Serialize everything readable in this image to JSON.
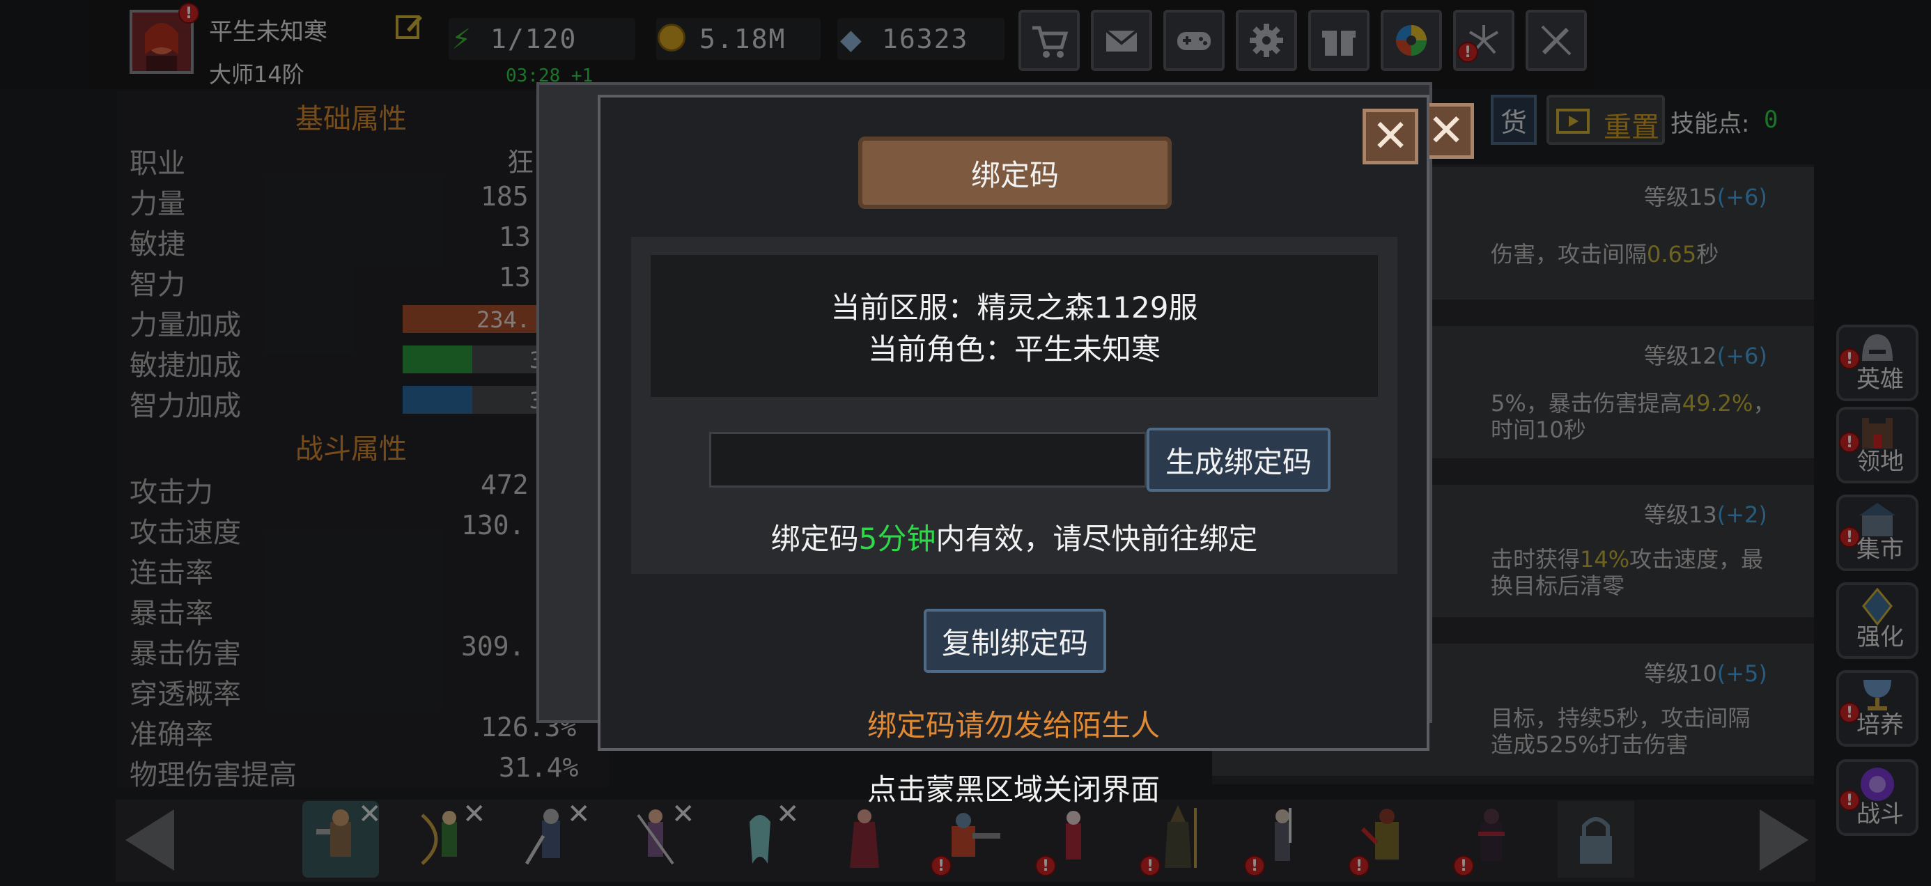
{
  "player": {
    "name": "平生未知寒",
    "rank": "大师14阶",
    "timer": "03:28 +1"
  },
  "resources": {
    "energy": "1/120",
    "gold": "5.18M",
    "gems": "16323"
  },
  "toolbar_icons": [
    "cart-icon",
    "mail-icon",
    "gamepad-icon",
    "gear-icon",
    "gift-icon",
    "color-wheel-icon",
    "fireworks-icon",
    "no-sword-icon"
  ],
  "stats": {
    "basic_title": "基础属性",
    "combat_title": "战斗属性",
    "basic": [
      {
        "name": "职业",
        "value": "狂"
      },
      {
        "name": "力量",
        "value": "185"
      },
      {
        "name": "敏捷",
        "value": "13"
      },
      {
        "name": "智力",
        "value": "13"
      }
    ],
    "bonuses": [
      {
        "name": "力量加成",
        "value": "234.",
        "color": "#a9512e",
        "fill": 1.0
      },
      {
        "name": "敏捷加成",
        "value": "3",
        "color": "#2a9a3c",
        "fill": 0.5
      },
      {
        "name": "智力加成",
        "value": "3",
        "color": "#2c6aa2",
        "fill": 0.5
      }
    ],
    "combat": [
      {
        "name": "攻击力",
        "value": "472"
      },
      {
        "name": "攻击速度",
        "value": "130."
      },
      {
        "name": "连击率",
        "value": ""
      },
      {
        "name": "暴击率",
        "value": ""
      },
      {
        "name": "暴击伤害",
        "value": "309."
      },
      {
        "name": "穿透概率",
        "value": ""
      },
      {
        "name": "准确率",
        "value": "126.3%"
      },
      {
        "name": "物理伤害提高",
        "value": "31.4%"
      }
    ]
  },
  "skills_header": {
    "reset_label": "重置",
    "partial_tab": "货",
    "points_label": "技能点:",
    "points_value": "0"
  },
  "skills": [
    {
      "level": "等级15",
      "bonus": "(+6)",
      "line1_a": "伤害，攻击间隔",
      "line1_hl": "0.65",
      "line1_b": "秒",
      "line2": ""
    },
    {
      "level": "等级12",
      "bonus": "(+6)",
      "line1_a": "5%，暴击伤害提高",
      "line1_hl": "49.2%",
      "line1_b": "，",
      "line2": "时间10秒"
    },
    {
      "level": "等级13",
      "bonus": "(+2)",
      "line1_a": "击时获得",
      "line1_hl": "14%",
      "line1_b": "攻击速度，最",
      "line2": "换目标后清零"
    },
    {
      "level": "等级10",
      "bonus": "(+5)",
      "line1_a": "目标，持续5秒，攻击间隔",
      "line1_hl": "",
      "line1_b": "",
      "line2": "造成525%打击伤害"
    }
  ],
  "side_nav": [
    {
      "label": "英雄",
      "icon": "helmet-icon"
    },
    {
      "label": "领地",
      "icon": "castle-icon"
    },
    {
      "label": "集市",
      "icon": "shop-icon"
    },
    {
      "label": "强化",
      "icon": "crystal-icon"
    },
    {
      "label": "培养",
      "icon": "chalice-icon"
    },
    {
      "label": "战斗",
      "icon": "portal-icon"
    }
  ],
  "dialog": {
    "title": "绑定码",
    "server_line": "当前区服：精灵之森1129服",
    "role_line": "当前角色：平生未知寒",
    "input_value": "",
    "generate_label": "生成绑定码",
    "validity_prefix": "绑定码",
    "validity_highlight": "5分钟",
    "validity_suffix": "内有效，请尽快前往绑定",
    "copy_label": "复制绑定码",
    "warning": "绑定码请勿发给陌生人",
    "close_hint": "点击蒙黑区域关闭界面",
    "close_icon": "close-x-icon"
  },
  "colors": {
    "accent_orange": "#d88a32",
    "highlight_green": "#2fd84a",
    "warning_orange": "#e08a36",
    "level_blue": "#4aa8e8",
    "value_yellow": "#c7b53a"
  }
}
